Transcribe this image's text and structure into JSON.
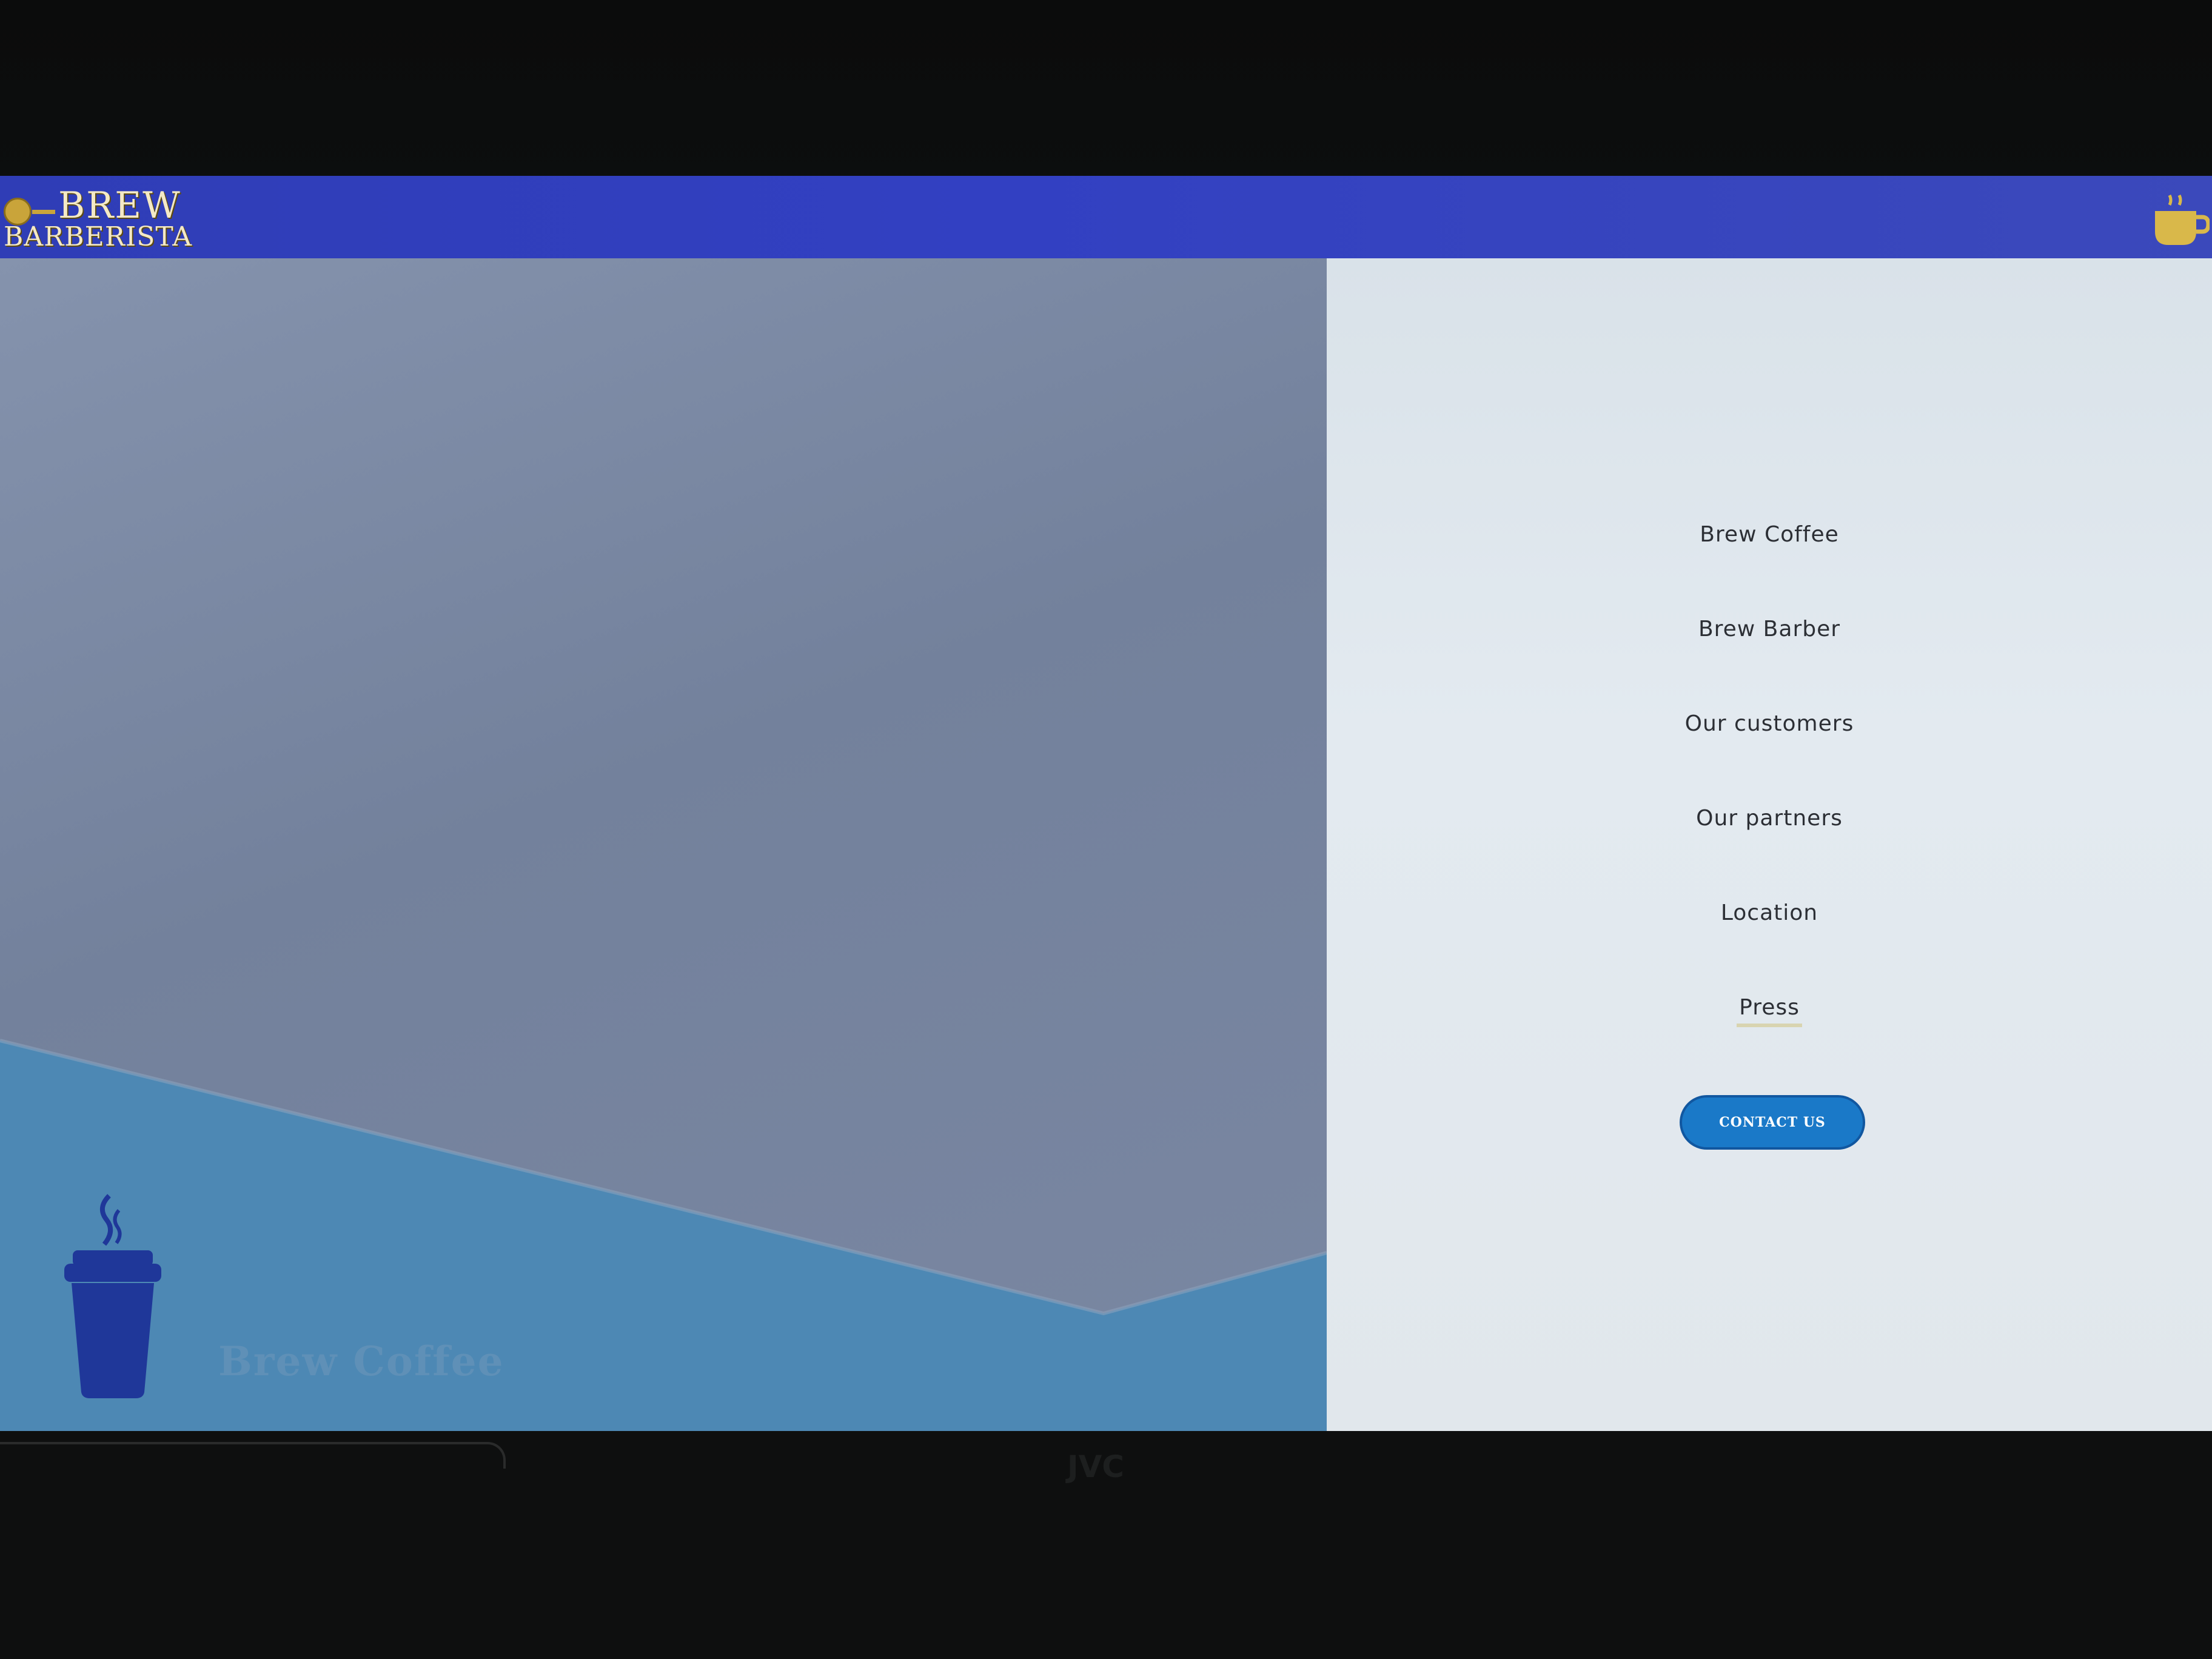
{
  "header": {
    "logo_line1": "BREW",
    "logo_line2": "BARBERISTA",
    "cart_icon": "coffee-cup-icon"
  },
  "hero": {
    "title": "Brew Coffee",
    "icon": "takeaway-coffee-cup-icon"
  },
  "nav": {
    "items": [
      {
        "label": "Brew Coffee"
      },
      {
        "label": "Brew Barber"
      },
      {
        "label": "Our customers"
      },
      {
        "label": "Our partners"
      },
      {
        "label": "Location"
      },
      {
        "label": "Press"
      }
    ],
    "contact_label": "CONTACT US"
  },
  "bezel": {
    "brand": "JVC"
  },
  "colors": {
    "header": "#3240c2",
    "hero_bg": "#73819c",
    "hero_wave": "#4d88b4",
    "nav_bg": "#e1e7ec",
    "contact_button": "#1a79c8",
    "cup": "#1f3799",
    "logo_gold": "#c9a43a"
  }
}
